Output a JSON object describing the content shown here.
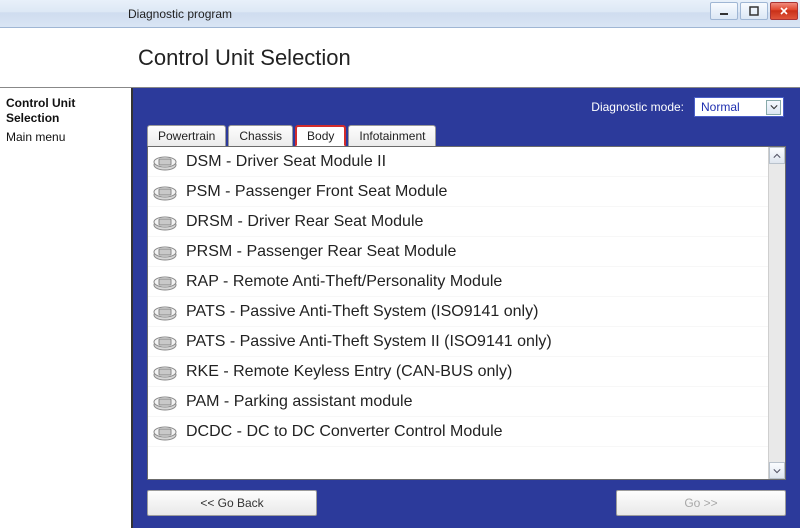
{
  "window": {
    "title": "Diagnostic program"
  },
  "header": {
    "title": "Control Unit Selection"
  },
  "sidebar": {
    "items": [
      {
        "label": "Control Unit Selection",
        "bold": true
      },
      {
        "label": "Main menu",
        "bold": false
      }
    ]
  },
  "mode": {
    "label": "Diagnostic mode:",
    "value": "Normal"
  },
  "tabs": [
    {
      "label": "Powertrain",
      "active": false
    },
    {
      "label": "Chassis",
      "active": false
    },
    {
      "label": "Body",
      "active": true
    },
    {
      "label": "Infotainment",
      "active": false
    }
  ],
  "modules": [
    "DSM - Driver Seat Module II",
    "PSM - Passenger Front Seat Module",
    "DRSM - Driver Rear Seat Module",
    "PRSM - Passenger Rear Seat Module",
    "RAP - Remote Anti-Theft/Personality Module",
    "PATS - Passive Anti-Theft System (ISO9141 only)",
    "PATS - Passive Anti-Theft System II (ISO9141 only)",
    "RKE - Remote Keyless Entry (CAN-BUS only)",
    "PAM - Parking assistant module",
    "DCDC - DC to DC Converter Control Module"
  ],
  "footer": {
    "back": "<< Go Back",
    "go": "Go >>"
  }
}
